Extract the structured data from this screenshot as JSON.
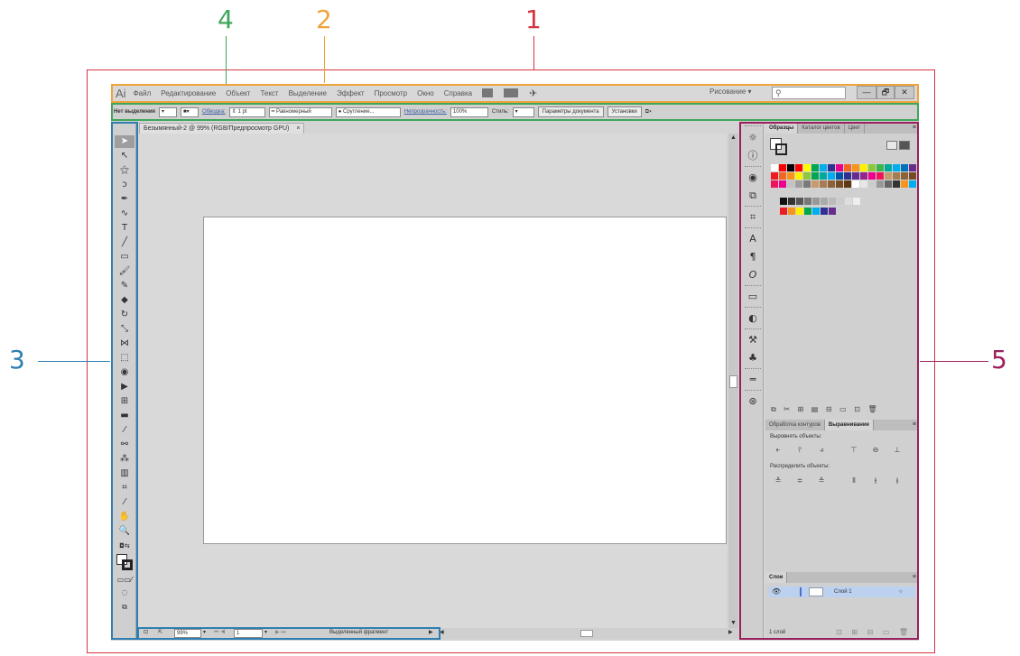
{
  "annotations": {
    "labels": [
      "1",
      "2",
      "3",
      "4",
      "5"
    ],
    "colors": {
      "1": "#d63341",
      "2": "#f0a23c",
      "3": "#2e7fb0",
      "4": "#3fa65a",
      "5": "#9b1f5c"
    }
  },
  "menubar": {
    "logo": "Ai",
    "items": [
      "Файл",
      "Редактирование",
      "Объект",
      "Текст",
      "Выделение",
      "Эффект",
      "Просмотр",
      "Окно",
      "Справка"
    ],
    "workspace": "Рисование",
    "search_icon": "⚲",
    "window_buttons": [
      "—",
      "🗗",
      "✕"
    ]
  },
  "controlbar": {
    "no_selection": "Нет выделения",
    "stroke_link": "Обводка:",
    "stroke_weight": "1 pt",
    "profile": "Равномерный",
    "brush": "Сругление...",
    "opacity_link": "Непрозрачность:",
    "opacity_value": "100%",
    "style_label": "Стиль:",
    "doc_setup_button": "Параметры документа",
    "prefs_button": "Установки"
  },
  "document": {
    "tab_title": "Безымянный-2 @ 99% (RGB/Предпросмотр GPU)",
    "tab_close": "×"
  },
  "statusbar": {
    "zoom": "99%",
    "artboard": "1",
    "status_text": "Выделенный фрагмент"
  },
  "panels": {
    "swatches_tabs": [
      "Образцы",
      "Каталог цветов",
      "Цвет"
    ],
    "pathfinder_tabs": [
      "Обработка контуров",
      "Выравнивание"
    ],
    "align_objects_label": "Выровнять объекты:",
    "distribute_objects_label": "Распределить объекты:",
    "layers_tab": "Слои",
    "layer_name": "Слой 1",
    "layers_count": "1 слой",
    "panel_menu_icon": "≡"
  },
  "icons": {
    "tools": [
      "selection-icon",
      "direct-selection-icon",
      "magic-wand-icon",
      "lasso-icon",
      "pen-icon",
      "curvature-icon",
      "type-icon",
      "line-segment-icon",
      "rectangle-icon",
      "paintbrush-icon",
      "pencil-icon",
      "eraser-icon",
      "rotate-icon",
      "scale-icon",
      "width-icon",
      "free-transform-icon",
      "shape-builder-icon",
      "perspective-grid-icon",
      "mesh-icon",
      "gradient-icon",
      "eyedropper-icon",
      "blend-icon",
      "symbol-sprayer-icon",
      "column-graph-icon",
      "artboard-icon",
      "slice-icon",
      "hand-icon",
      "zoom-icon"
    ],
    "strip": [
      "sun-icon",
      "info-icon",
      "appearance-icon",
      "graphic-styles-icon",
      "transform-icon",
      "character-icon",
      "paragraph-icon",
      "opentype-icon",
      "gradient-panel-icon",
      "transparency-icon",
      "brushes-icon",
      "symbols-icon",
      "stroke-icon",
      "links-icon"
    ]
  }
}
